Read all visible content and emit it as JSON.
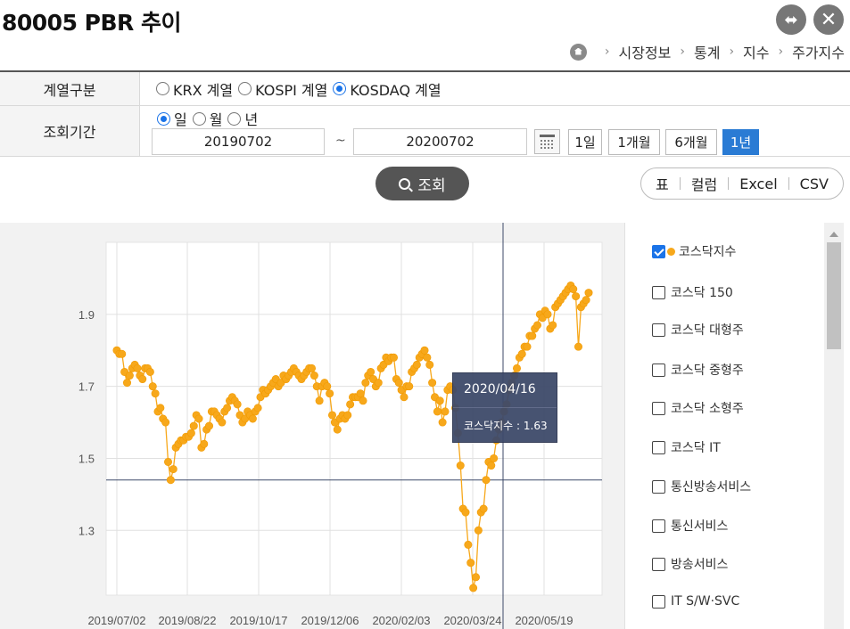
{
  "header": {
    "title": "80005 PBR 추이"
  },
  "breadcrumb": [
    "시장정보",
    "통계",
    "지수",
    "주가지수"
  ],
  "form": {
    "series_label": "계열구분",
    "series_options": [
      {
        "label": "KRX 계열",
        "selected": false
      },
      {
        "label": "KOSPI 계열",
        "selected": false
      },
      {
        "label": "KOSDAQ 계열",
        "selected": true
      }
    ],
    "period_label": "조회기간",
    "period_units": [
      {
        "label": "일",
        "selected": true
      },
      {
        "label": "월",
        "selected": false
      },
      {
        "label": "년",
        "selected": false
      }
    ],
    "start_date": "20190702",
    "tilde": "~",
    "end_date": "20200702",
    "quick_periods": [
      {
        "label": "1일",
        "selected": false
      },
      {
        "label": "1개월",
        "selected": false
      },
      {
        "label": "6개월",
        "selected": false
      },
      {
        "label": "1년",
        "selected": true
      }
    ],
    "search_label": "조회"
  },
  "view_tabs": [
    "표",
    "컬럼",
    "Excel",
    "CSV"
  ],
  "tooltip": {
    "date": "2020/04/16",
    "value_text": "코스닥지수 : 1.63"
  },
  "legend": [
    {
      "label": "코스닥지수",
      "checked": true,
      "color": "#f7a81b"
    },
    {
      "label": "코스닥 150",
      "checked": false
    },
    {
      "label": "코스닥 대형주",
      "checked": false
    },
    {
      "label": "코스닥 중형주",
      "checked": false
    },
    {
      "label": "코스닥 소형주",
      "checked": false
    },
    {
      "label": "코스닥 IT",
      "checked": false
    },
    {
      "label": "통신방송서비스",
      "checked": false
    },
    {
      "label": "통신서비스",
      "checked": false
    },
    {
      "label": "방송서비스",
      "checked": false
    },
    {
      "label": "IT S/W·SVC",
      "checked": false
    }
  ],
  "chart_data": {
    "type": "line",
    "series": [
      {
        "name": "코스닥지수",
        "color": "#f7a81b",
        "values": [
          1.8,
          1.79,
          1.79,
          1.74,
          1.71,
          1.73,
          1.75,
          1.76,
          1.75,
          1.73,
          1.72,
          1.75,
          1.75,
          1.74,
          1.7,
          1.68,
          1.63,
          1.64,
          1.61,
          1.6,
          1.49,
          1.44,
          1.47,
          1.53,
          1.54,
          1.55,
          1.55,
          1.56,
          1.56,
          1.57,
          1.59,
          1.62,
          1.61,
          1.53,
          1.54,
          1.58,
          1.59,
          1.63,
          1.63,
          1.62,
          1.61,
          1.6,
          1.63,
          1.64,
          1.66,
          1.67,
          1.66,
          1.65,
          1.62,
          1.6,
          1.61,
          1.63,
          1.62,
          1.61,
          1.63,
          1.64,
          1.67,
          1.69,
          1.68,
          1.69,
          1.7,
          1.71,
          1.72,
          1.7,
          1.71,
          1.73,
          1.72,
          1.73,
          1.74,
          1.75,
          1.74,
          1.73,
          1.72,
          1.73,
          1.74,
          1.75,
          1.75,
          1.73,
          1.7,
          1.66,
          1.7,
          1.71,
          1.7,
          1.68,
          1.62,
          1.6,
          1.58,
          1.61,
          1.62,
          1.61,
          1.62,
          1.65,
          1.67,
          1.67,
          1.67,
          1.68,
          1.66,
          1.71,
          1.73,
          1.74,
          1.72,
          1.7,
          1.71,
          1.75,
          1.76,
          1.78,
          1.77,
          1.78,
          1.78,
          1.72,
          1.71,
          1.69,
          1.67,
          1.7,
          1.7,
          1.74,
          1.75,
          1.76,
          1.78,
          1.79,
          1.8,
          1.78,
          1.76,
          1.71,
          1.67,
          1.63,
          1.66,
          1.6,
          1.63,
          1.69,
          1.7,
          1.69,
          1.64,
          1.57,
          1.48,
          1.36,
          1.35,
          1.26,
          1.21,
          1.14,
          1.17,
          1.3,
          1.35,
          1.36,
          1.44,
          1.49,
          1.48,
          1.5,
          1.55,
          1.58,
          1.6,
          1.63,
          1.65,
          1.69,
          1.71,
          1.73,
          1.75,
          1.78,
          1.79,
          1.81,
          1.81,
          1.84,
          1.84,
          1.86,
          1.87,
          1.9,
          1.89,
          1.91,
          1.9,
          1.86,
          1.87,
          1.92,
          1.93,
          1.94,
          1.95,
          1.96,
          1.97,
          1.98,
          1.97,
          1.95,
          1.81,
          1.92,
          1.93,
          1.94,
          1.96
        ]
      }
    ],
    "x_tick_labels": [
      "2019/07/02",
      "2019/08/22",
      "2019/10/17",
      "2019/12/06",
      "2020/02/03",
      "2020/03/24",
      "2020/05/19"
    ],
    "y_ticks": [
      1.3,
      1.5,
      1.7,
      1.9
    ],
    "ylim": [
      1.12,
      2.1
    ],
    "grid": true,
    "crosshair": {
      "x_label": "2020/04/16",
      "y_value": 1.44
    }
  }
}
